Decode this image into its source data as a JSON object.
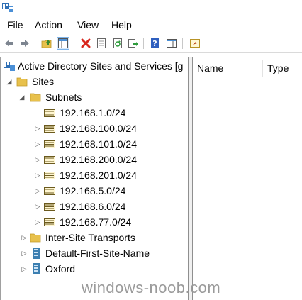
{
  "menu": {
    "file": "File",
    "action": "Action",
    "view": "View",
    "help": "Help"
  },
  "tree": {
    "root": {
      "label": "Active Directory Sites and Services [g"
    },
    "sites": {
      "label": "Sites"
    },
    "subnets": {
      "label": "Subnets"
    },
    "subnet_items": [
      {
        "label": "192.168.1.0/24"
      },
      {
        "label": "192.168.100.0/24"
      },
      {
        "label": "192.168.101.0/24"
      },
      {
        "label": "192.168.200.0/24"
      },
      {
        "label": "192.168.201.0/24"
      },
      {
        "label": "192.168.5.0/24"
      },
      {
        "label": "192.168.6.0/24"
      },
      {
        "label": "192.168.77.0/24"
      }
    ],
    "inter_site": {
      "label": "Inter-Site Transports"
    },
    "default_site": {
      "label": "Default-First-Site-Name"
    },
    "oxford": {
      "label": "Oxford"
    }
  },
  "list": {
    "columns": {
      "name": "Name",
      "type": "Type"
    }
  },
  "watermark": "windows-noob.com",
  "colors": {
    "folder": "#e8c14c",
    "selection": "#d5e8fb",
    "accent": "#3c7fb1"
  }
}
